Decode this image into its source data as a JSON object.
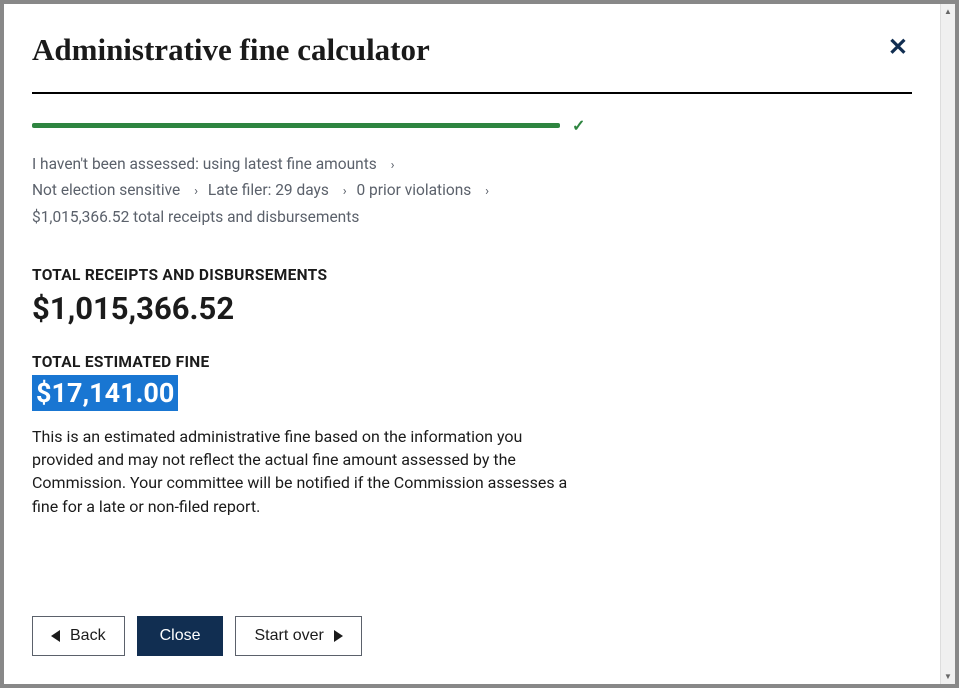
{
  "modal": {
    "title": "Administrative fine calculator"
  },
  "breadcrumb": {
    "items": [
      "I haven't been assessed: using latest fine amounts",
      "Not election sensitive",
      "Late filer: 29 days",
      "0 prior violations",
      "$1,015,366.52 total receipts and disbursements"
    ]
  },
  "totals": {
    "receipts_label": "TOTAL RECEIPTS AND DISBURSEMENTS",
    "receipts_value": "$1,015,366.52",
    "fine_label": "TOTAL ESTIMATED FINE",
    "fine_value": "$17,141.00"
  },
  "disclaimer": "This is an estimated administrative fine based on the information you provided and may not reflect the actual fine amount assessed by the Commission. Your committee will be notified if the Commission assesses a fine for a late or non-filed report.",
  "buttons": {
    "back": "Back",
    "close": "Close",
    "start_over": "Start over"
  }
}
